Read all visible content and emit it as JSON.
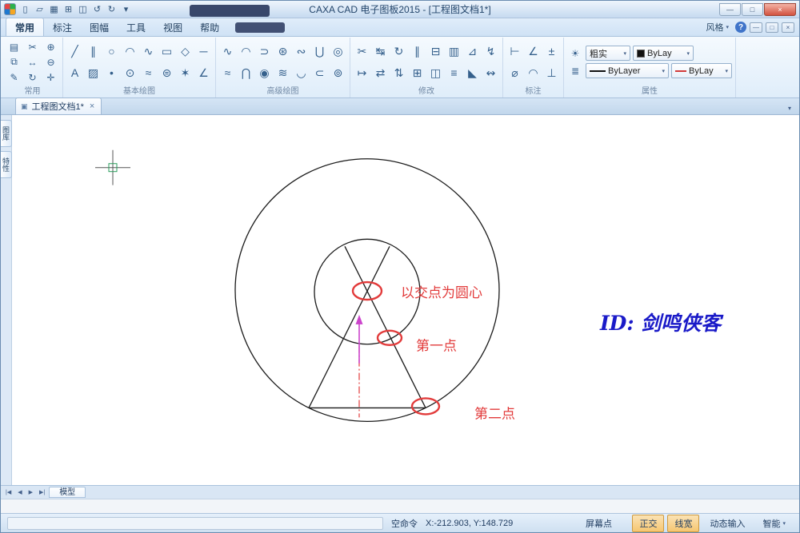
{
  "window": {
    "title": "CAXA CAD 电子图板2015 - [工程图文档1*]"
  },
  "icons": {
    "dropdown": "▾",
    "minimize": "—",
    "maximize": "□",
    "close": "×",
    "help": "?",
    "document": "▣",
    "doc_close": "×",
    "overflow": "▾",
    "layer_settings": "☀",
    "layer_list": "≣",
    "nav_first": "|◀",
    "nav_prev": "◀",
    "nav_next": "▶",
    "nav_last": "▶|"
  },
  "qat": [
    {
      "name": "new-file-icon",
      "glyph": "▯"
    },
    {
      "name": "open-file-icon",
      "glyph": "▱"
    },
    {
      "name": "save-icon",
      "glyph": "▦"
    },
    {
      "name": "print-icon",
      "glyph": "⊞"
    },
    {
      "name": "print-preview-icon",
      "glyph": "◫"
    },
    {
      "name": "undo-icon",
      "glyph": "↺"
    },
    {
      "name": "redo-icon",
      "glyph": "↻"
    },
    {
      "name": "customize-qat-icon",
      "glyph": "▾"
    }
  ],
  "ribbon_tabs": [
    "常用",
    "标注",
    "图幅",
    "工具",
    "视图",
    "帮助"
  ],
  "style_button": "风格",
  "groups": {
    "common": {
      "label": "常用",
      "icons": [
        {
          "name": "paste-icon",
          "glyph": "▤"
        },
        {
          "name": "copy-icon",
          "glyph": "⧉"
        },
        {
          "name": "format-brush-icon",
          "glyph": "✎"
        },
        {
          "name": "cut-icon",
          "glyph": "✂"
        },
        {
          "name": "move-icon",
          "glyph": "↔"
        },
        {
          "name": "rotate-icon",
          "glyph": "↻"
        },
        {
          "name": "zoom-in-icon",
          "glyph": "⊕"
        },
        {
          "name": "zoom-out-icon",
          "glyph": "⊖"
        },
        {
          "name": "pan-icon",
          "glyph": "✛"
        }
      ]
    },
    "basic_draw": {
      "label": "基本绘图",
      "icons": [
        {
          "name": "line-icon",
          "glyph": "╱"
        },
        {
          "name": "text-icon",
          "glyph": "A"
        },
        {
          "name": "parallel-line-icon",
          "glyph": "∥"
        },
        {
          "name": "hatch-icon",
          "glyph": "▨"
        },
        {
          "name": "circle-icon",
          "glyph": "○"
        },
        {
          "name": "point-icon",
          "glyph": "•"
        },
        {
          "name": "arc-icon",
          "glyph": "◠"
        },
        {
          "name": "center-line-icon",
          "glyph": "⊙"
        },
        {
          "name": "spline-icon",
          "glyph": "∿"
        },
        {
          "name": "wave-line-icon",
          "glyph": "≈"
        },
        {
          "name": "rectangle-icon",
          "glyph": "▭"
        },
        {
          "name": "ellipse-icon",
          "glyph": "⊜"
        },
        {
          "name": "polygon-icon",
          "glyph": "◇"
        },
        {
          "name": "star-icon",
          "glyph": "✶"
        },
        {
          "name": "segment-icon",
          "glyph": "─"
        },
        {
          "name": "angle-line-icon",
          "glyph": "∠"
        }
      ]
    },
    "adv_draw": {
      "label": "高级绘图",
      "icons": [
        {
          "name": "spline-curve-icon",
          "glyph": "∿"
        },
        {
          "name": "fit-curve-icon",
          "glyph": "≈"
        },
        {
          "name": "arc-up-icon",
          "glyph": "◠"
        },
        {
          "name": "intersection-icon",
          "glyph": "⋂"
        },
        {
          "name": "hook-curve-icon",
          "glyph": "⊃"
        },
        {
          "name": "ring-icon",
          "glyph": "◉"
        },
        {
          "name": "circled-star-icon",
          "glyph": "⊛"
        },
        {
          "name": "triple-wave-icon",
          "glyph": "≋"
        },
        {
          "name": "inverse-curve-icon",
          "glyph": "∾"
        },
        {
          "name": "arc-down-icon",
          "glyph": "◡"
        },
        {
          "name": "union-curve-icon",
          "glyph": "⋃"
        },
        {
          "name": "subset-curve-icon",
          "glyph": "⊂"
        },
        {
          "name": "bullseye-icon",
          "glyph": "◎"
        },
        {
          "name": "donut-icon",
          "glyph": "⊚"
        }
      ]
    },
    "modify": {
      "label": "修改",
      "icons": [
        {
          "name": "trim-icon",
          "glyph": "✂"
        },
        {
          "name": "extend-icon",
          "glyph": "↦"
        },
        {
          "name": "stretch-icon",
          "glyph": "↹"
        },
        {
          "name": "translate-icon",
          "glyph": "⇄"
        },
        {
          "name": "rotate-entity-icon",
          "glyph": "↻"
        },
        {
          "name": "flip-icon",
          "glyph": "⇅"
        },
        {
          "name": "offset-icon",
          "glyph": "∥"
        },
        {
          "name": "array-icon",
          "glyph": "⊞"
        },
        {
          "name": "explode-icon",
          "glyph": "⊟"
        },
        {
          "name": "mirror-icon",
          "glyph": "◫"
        },
        {
          "name": "pattern-icon",
          "glyph": "▥"
        },
        {
          "name": "match-properties-icon",
          "glyph": "≡"
        },
        {
          "name": "chamfer-icon",
          "glyph": "⊿"
        },
        {
          "name": "fillet-icon",
          "glyph": "◣"
        },
        {
          "name": "break-icon",
          "glyph": "↯"
        },
        {
          "name": "scale-icon",
          "glyph": "↭"
        }
      ]
    },
    "dimension": {
      "label": "标注",
      "icons": [
        {
          "name": "linear-dimension-icon",
          "glyph": "⊢"
        },
        {
          "name": "diameter-dimension-icon",
          "glyph": "⌀"
        },
        {
          "name": "angle-dimension-icon",
          "glyph": "∠"
        },
        {
          "name": "arc-dimension-icon",
          "glyph": "◠"
        },
        {
          "name": "tolerance-dimension-icon",
          "glyph": "±"
        },
        {
          "name": "datum-dimension-icon",
          "glyph": "⊥"
        }
      ]
    },
    "properties": {
      "label": "属性",
      "line_style": "粗实",
      "color": "ByLay",
      "linetype": "ByLayer",
      "linewidth": "ByLay"
    }
  },
  "doc_tab": "工程图文档1*",
  "side_tabs": [
    "图库",
    "特性"
  ],
  "canvas": {
    "label_center": "以交点为圆心",
    "label_first": "第一点",
    "label_second": "第二点",
    "watermark": "ID: 剑鸣侠客"
  },
  "model_tab": "模型",
  "statusbar": {
    "command": "空命令",
    "coords": "X:-212.903, Y:148.729",
    "point_mode": "屏幕点",
    "ortho": "正交",
    "linewidth": "线宽",
    "dynamic_input": "动态输入",
    "smart": "智能"
  },
  "colors": {
    "annotation_red": "#e23b3b",
    "watermark_blue": "#1a1ac8",
    "arrow_magenta": "#cc44cc",
    "pickbox_green": "#2a9d5c",
    "toggle_active_orange": "#f6c671"
  }
}
